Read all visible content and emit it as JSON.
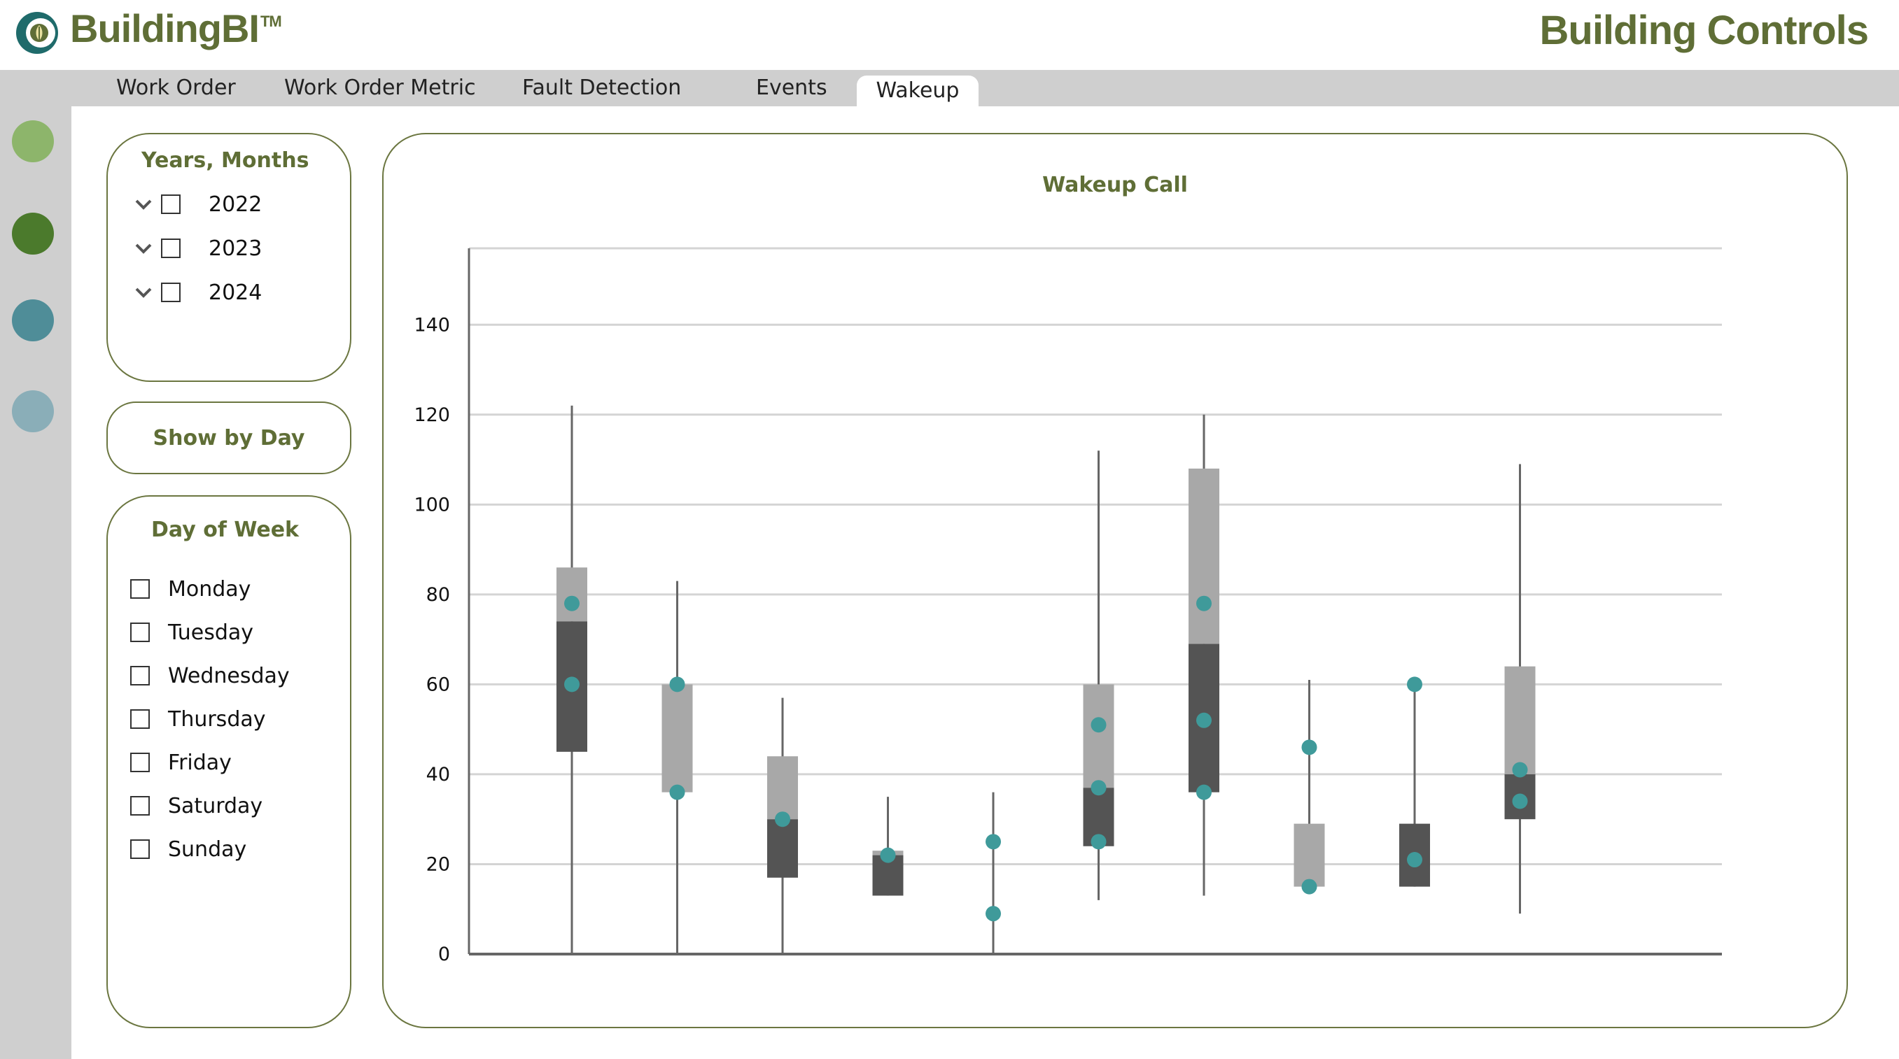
{
  "header": {
    "brand": "BuildingBI",
    "trademark": "TM",
    "title": "Building Controls",
    "logo_icon": "leaf-c-logo-icon"
  },
  "tabs": [
    {
      "label": "Work Order",
      "active": false
    },
    {
      "label": "Work Order Metric",
      "active": false
    },
    {
      "label": "Fault Detection",
      "active": false
    },
    {
      "label": "Events",
      "active": false
    },
    {
      "label": "Wakeup",
      "active": true
    }
  ],
  "rail": {
    "dots": [
      {
        "name": "nav-dot-light-green",
        "color": "#8db56b"
      },
      {
        "name": "nav-dot-dark-green",
        "color": "#4b7a2c"
      },
      {
        "name": "nav-dot-teal",
        "color": "#4f8d98"
      },
      {
        "name": "nav-dot-light-teal",
        "color": "#8aaeb8"
      }
    ]
  },
  "filters": {
    "years_title": "Years, Months",
    "years": [
      "2022",
      "2023",
      "2024"
    ],
    "show_by_day": "Show by Day",
    "day_title": "Day of Week",
    "days": [
      "Monday",
      "Tuesday",
      "Wednesday",
      "Thursday",
      "Friday",
      "Saturday",
      "Sunday"
    ]
  },
  "colors": {
    "accent_olive": "#5f6e36",
    "box_light": "#a8a8a8",
    "box_dark": "#545454",
    "marker_teal": "#3f9a9a",
    "whisker": "#666666"
  },
  "chart_data": {
    "type": "boxplot",
    "title": "Wakeup Call",
    "ylim": [
      0,
      157
    ],
    "yticks": [
      0,
      20,
      40,
      60,
      80,
      100,
      120,
      140
    ],
    "grid": true,
    "boxes": [
      {
        "min": 0,
        "q1": 45,
        "median": 74,
        "q3": 86,
        "max": 122,
        "markers": [
          78,
          60
        ]
      },
      {
        "min": 0,
        "q1": 36,
        "median": 36,
        "q3": 60,
        "max": 83,
        "markers": [
          60,
          36
        ]
      },
      {
        "min": 0,
        "q1": 17,
        "median": 30,
        "q3": 44,
        "max": 57,
        "markers": [
          30
        ]
      },
      {
        "min": 13,
        "q1": 13,
        "median": 22,
        "q3": 23,
        "max": 35,
        "markers": [
          22
        ]
      },
      {
        "min": 0,
        "q1": null,
        "median": null,
        "q3": null,
        "max": 36,
        "markers": [
          25,
          9
        ]
      },
      {
        "min": 12,
        "q1": 24,
        "median": 37,
        "q3": 60,
        "max": 112,
        "markers": [
          51,
          37,
          25
        ]
      },
      {
        "min": 13,
        "q1": 36,
        "median": 69,
        "q3": 108,
        "max": 120,
        "markers": [
          78,
          52,
          36
        ]
      },
      {
        "min": 15,
        "q1": 15,
        "median": 15,
        "q3": 29,
        "max": 61,
        "markers": [
          46,
          15
        ]
      },
      {
        "min": 15,
        "q1": 15,
        "median": 29,
        "q3": 29,
        "max": 60,
        "markers": [
          60,
          21
        ]
      },
      {
        "min": 9,
        "q1": 30,
        "median": 40,
        "q3": 64,
        "max": 109,
        "markers": [
          41,
          34
        ]
      }
    ]
  }
}
